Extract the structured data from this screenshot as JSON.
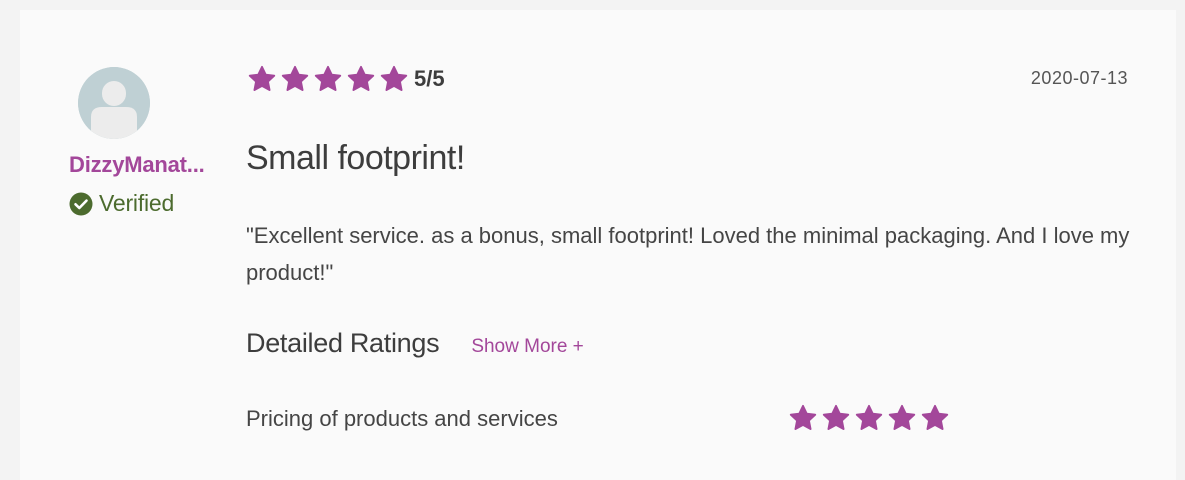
{
  "review": {
    "user": {
      "name": "DizzyManat...",
      "verified_label": "Verified"
    },
    "rating": {
      "stars": 5,
      "max": 5,
      "score_text": "5/5"
    },
    "date": "2020-07-13",
    "title": "Small footprint!",
    "body": "\"Excellent service. as a bonus, small footprint! Loved the minimal packaging. And I love my product!\"",
    "detailed_ratings": {
      "heading": "Detailed Ratings",
      "show_more_label": "Show More +",
      "items": [
        {
          "label": "Pricing of products and services",
          "stars": 5
        }
      ]
    }
  },
  "colors": {
    "star": "#a3479a",
    "username": "#a3479a",
    "verified": "#4c6b2e",
    "avatar_bg": "#bfd0d4"
  },
  "icons": {
    "avatar": "user-silhouette-icon",
    "verified": "check-circle-icon",
    "star": "star-icon"
  }
}
